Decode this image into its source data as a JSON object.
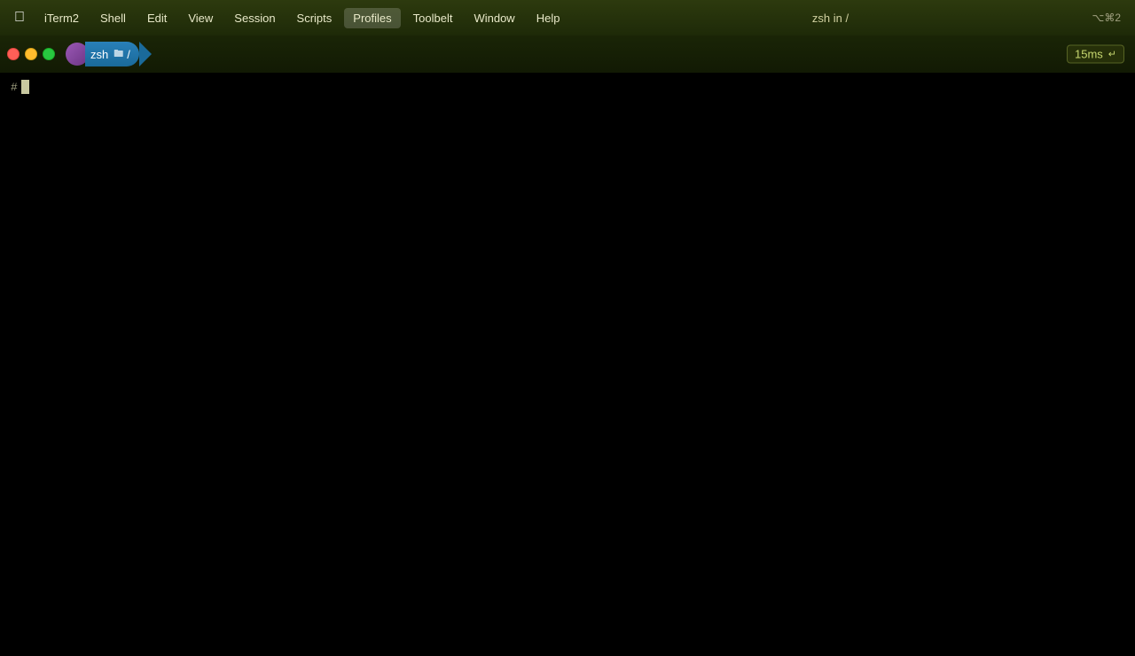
{
  "menubar": {
    "apple_icon": "🍎",
    "app_name": "iTerm2",
    "items": [
      {
        "label": "iTerm2",
        "id": "iterm2"
      },
      {
        "label": "Shell",
        "id": "shell"
      },
      {
        "label": "Edit",
        "id": "edit"
      },
      {
        "label": "View",
        "id": "view"
      },
      {
        "label": "Session",
        "id": "session"
      },
      {
        "label": "Scripts",
        "id": "scripts"
      },
      {
        "label": "Profiles",
        "id": "profiles",
        "hovered": true
      },
      {
        "label": "Toolbelt",
        "id": "toolbelt"
      },
      {
        "label": "Window",
        "id": "window"
      },
      {
        "label": "Help",
        "id": "help"
      }
    ],
    "title": "zsh in /",
    "shortcut": "⌥⌘2"
  },
  "tab": {
    "profile_letter": "",
    "name": "zsh",
    "folder_icon": "🗂",
    "path": "/"
  },
  "timer": {
    "value": "15ms",
    "arrow": "↵"
  },
  "terminal": {
    "prompt_symbol": "#",
    "cursor": ""
  }
}
